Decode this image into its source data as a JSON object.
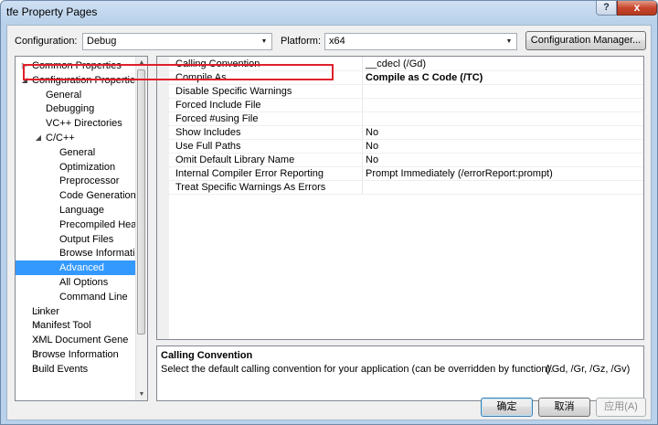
{
  "window": {
    "title": "tfe Property Pages",
    "help": "?",
    "close": "x"
  },
  "config": {
    "configuration_label": "Configuration:",
    "configuration_value": "Debug",
    "platform_label": "Platform:",
    "platform_value": "x64",
    "manager_button": "Configuration Manager..."
  },
  "tree": {
    "items": [
      {
        "label": "Common Properties",
        "expander": "▷"
      },
      {
        "label": "Configuration Properties",
        "expander": "◢"
      },
      {
        "label": "General"
      },
      {
        "label": "Debugging"
      },
      {
        "label": "VC++ Directories"
      },
      {
        "label": "C/C++",
        "expander": "◢"
      },
      {
        "label": "General"
      },
      {
        "label": "Optimization"
      },
      {
        "label": "Preprocessor"
      },
      {
        "label": "Code Generation"
      },
      {
        "label": "Language"
      },
      {
        "label": "Precompiled Heade"
      },
      {
        "label": "Output Files"
      },
      {
        "label": "Browse Informatio"
      },
      {
        "label": "Advanced"
      },
      {
        "label": "All Options"
      },
      {
        "label": "Command Line"
      },
      {
        "label": "Linker",
        "expander": "▷"
      },
      {
        "label": "Manifest Tool",
        "expander": "▷"
      },
      {
        "label": "XML Document Gene",
        "expander": "▷"
      },
      {
        "label": "Browse Information",
        "expander": "▷"
      },
      {
        "label": "Build Events",
        "expander": "▷"
      }
    ],
    "scroll_up": "▲",
    "scroll_down": "▼"
  },
  "properties": {
    "rows": [
      {
        "name": "Calling Convention",
        "value": "__cdecl (/Gd)"
      },
      {
        "name": "Compile As",
        "value": "Compile as C Code (/TC)"
      },
      {
        "name": "Disable Specific Warnings",
        "value": ""
      },
      {
        "name": "Forced Include File",
        "value": ""
      },
      {
        "name": "Forced #using File",
        "value": ""
      },
      {
        "name": "Show Includes",
        "value": "No"
      },
      {
        "name": "Use Full Paths",
        "value": "No"
      },
      {
        "name": "Omit Default Library Name",
        "value": "No"
      },
      {
        "name": "Internal Compiler Error Reporting",
        "value": "Prompt Immediately (/errorReport:prompt)"
      },
      {
        "name": "Treat Specific Warnings As Errors",
        "value": ""
      }
    ]
  },
  "description": {
    "title": "Calling Convention",
    "text": "Select the default calling convention for your application (can be overridden by function).",
    "flags": "(/Gd, /Gr, /Gz, /Gv)"
  },
  "buttons": {
    "ok": "确定",
    "cancel": "取消",
    "apply": "应用(A)"
  },
  "colors": {
    "selection": "#3399ff",
    "highlight_box": "#e0202a"
  }
}
